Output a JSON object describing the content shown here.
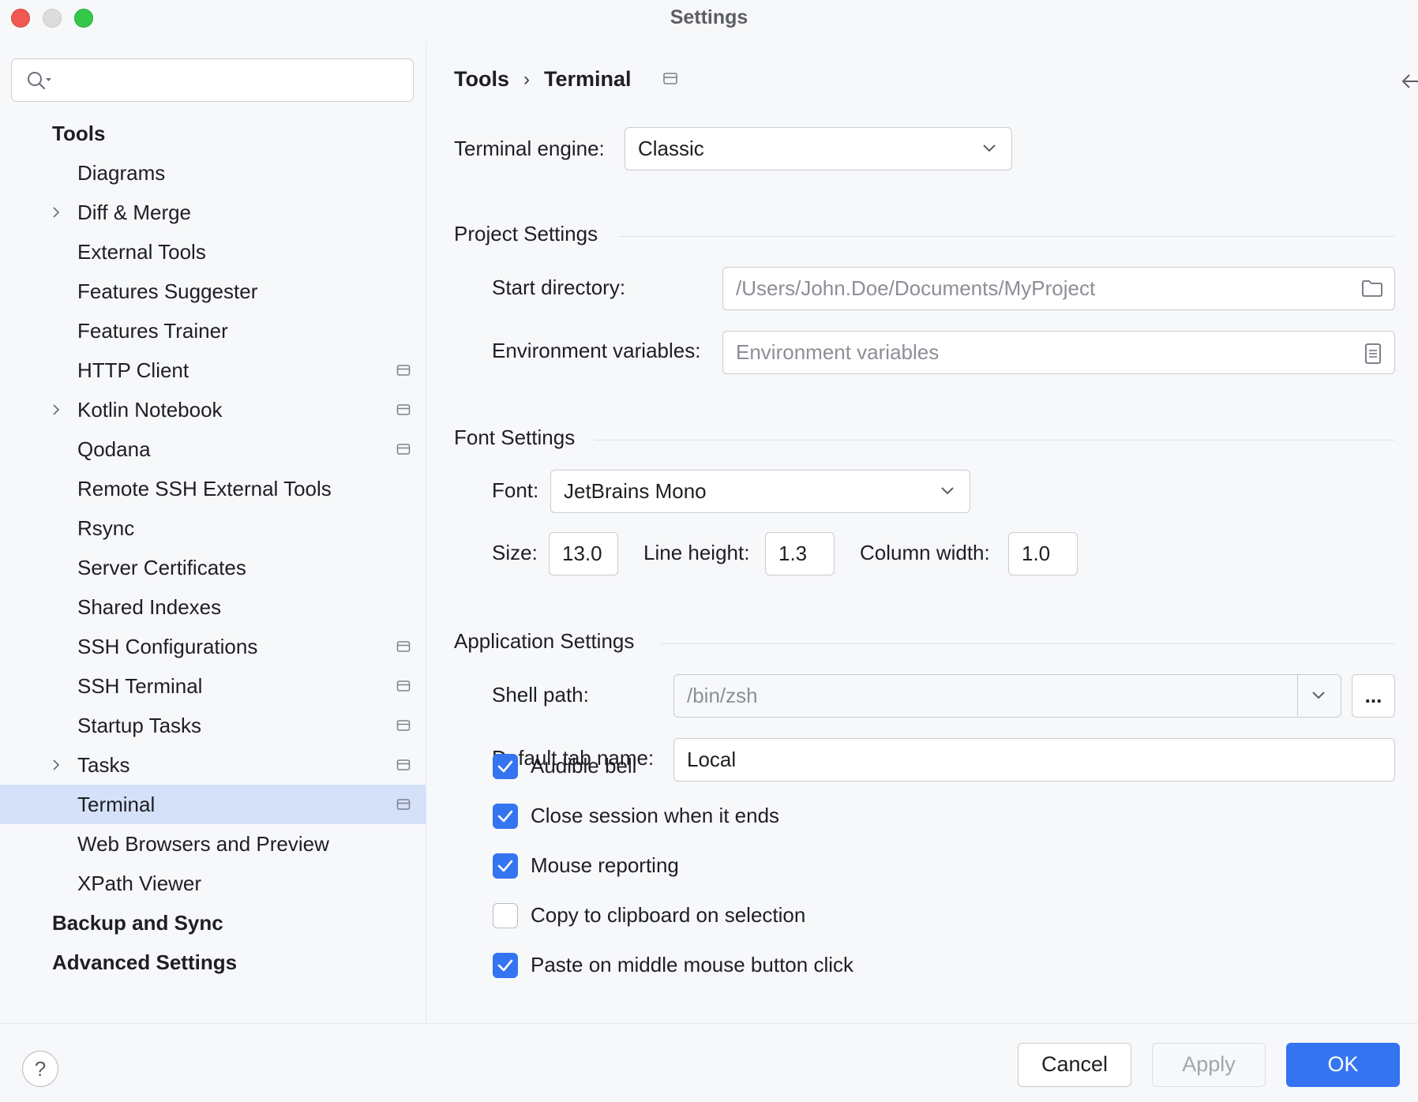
{
  "window": {
    "title": "Settings"
  },
  "search": {
    "placeholder": ""
  },
  "sidebar": {
    "items": [
      {
        "label": "Tools",
        "kind": "category"
      },
      {
        "label": "Diagrams",
        "kind": "sub"
      },
      {
        "label": "Diff & Merge",
        "kind": "sub",
        "expandable": true
      },
      {
        "label": "External Tools",
        "kind": "sub"
      },
      {
        "label": "Features Suggester",
        "kind": "sub"
      },
      {
        "label": "Features Trainer",
        "kind": "sub"
      },
      {
        "label": "HTTP Client",
        "kind": "sub",
        "project_icon": true
      },
      {
        "label": "Kotlin Notebook",
        "kind": "sub",
        "expandable": true,
        "project_icon": true
      },
      {
        "label": "Qodana",
        "kind": "sub",
        "project_icon": true
      },
      {
        "label": "Remote SSH External Tools",
        "kind": "sub"
      },
      {
        "label": "Rsync",
        "kind": "sub"
      },
      {
        "label": "Server Certificates",
        "kind": "sub"
      },
      {
        "label": "Shared Indexes",
        "kind": "sub"
      },
      {
        "label": "SSH Configurations",
        "kind": "sub",
        "project_icon": true
      },
      {
        "label": "SSH Terminal",
        "kind": "sub",
        "project_icon": true
      },
      {
        "label": "Startup Tasks",
        "kind": "sub",
        "project_icon": true
      },
      {
        "label": "Tasks",
        "kind": "sub",
        "expandable": true,
        "project_icon": true
      },
      {
        "label": "Terminal",
        "kind": "sub",
        "project_icon": true,
        "selected": true
      },
      {
        "label": "Web Browsers and Preview",
        "kind": "sub"
      },
      {
        "label": "XPath Viewer",
        "kind": "sub"
      },
      {
        "label": "Backup and Sync",
        "kind": "category"
      },
      {
        "label": "Advanced Settings",
        "kind": "category"
      }
    ]
  },
  "breadcrumb": {
    "parent": "Tools",
    "separator": "›",
    "current": "Terminal"
  },
  "engine": {
    "label": "Terminal engine:",
    "value": "Classic"
  },
  "project_settings": {
    "title": "Project Settings",
    "start_directory": {
      "label": "Start directory:",
      "placeholder": "/Users/John.Doe/Documents/MyProject"
    },
    "env_vars": {
      "label": "Environment variables:",
      "placeholder": "Environment variables"
    }
  },
  "font_settings": {
    "title": "Font Settings",
    "font": {
      "label": "Font:",
      "value": "JetBrains Mono"
    },
    "size": {
      "label": "Size:",
      "value": "13.0"
    },
    "line_height": {
      "label": "Line height:",
      "value": "1.3"
    },
    "column_width": {
      "label": "Column width:",
      "value": "1.0"
    }
  },
  "app_settings": {
    "title": "Application Settings",
    "shell_path": {
      "label": "Shell path:",
      "placeholder": "/bin/zsh",
      "browse": "..."
    },
    "tab_name": {
      "label": "Default tab name:",
      "value": "Local"
    },
    "checkboxes": [
      {
        "label": "Audible bell",
        "checked": true
      },
      {
        "label": "Close session when it ends",
        "checked": true
      },
      {
        "label": "Mouse reporting",
        "checked": true
      },
      {
        "label": "Copy to clipboard on selection",
        "checked": false
      },
      {
        "label": "Paste on middle mouse button click",
        "checked": true
      }
    ]
  },
  "footer": {
    "help": "?",
    "cancel": "Cancel",
    "apply": "Apply",
    "ok": "OK"
  },
  "colors": {
    "accent": "#3574f0",
    "selection": "#d5e1f9",
    "background": "#f7f8fa"
  },
  "icons": [
    "search-icon",
    "chevron-right-icon",
    "project-scope-icon",
    "back-arrow-icon",
    "forward-arrow-icon",
    "chevron-down-icon",
    "folder-icon",
    "document-icon",
    "checkmark-icon",
    "help-icon"
  ]
}
